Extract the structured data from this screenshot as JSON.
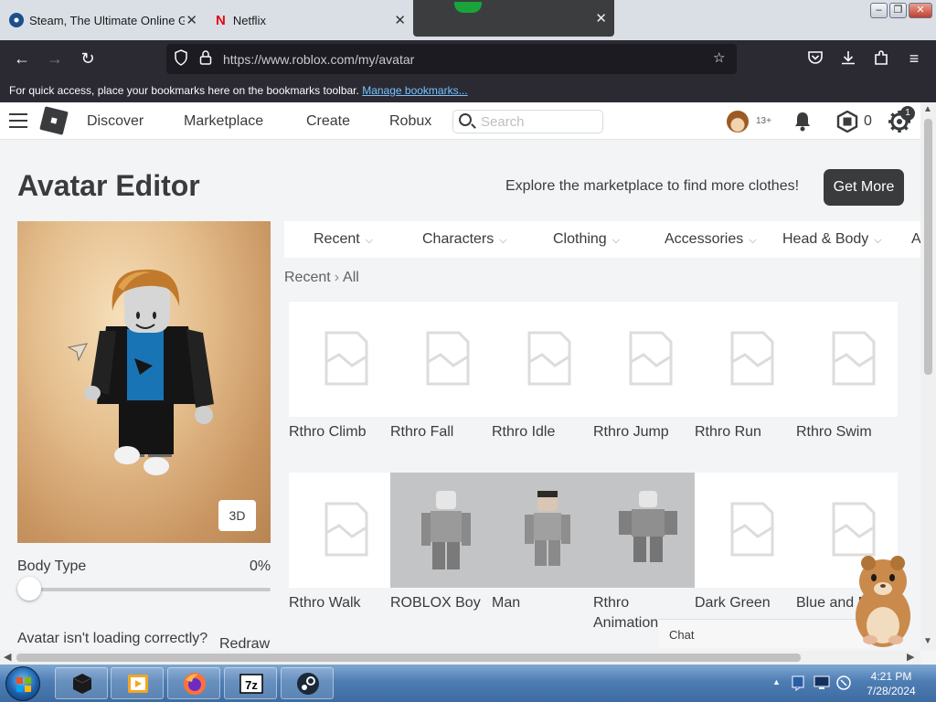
{
  "browser": {
    "tabs": [
      {
        "title": "Steam, The Ultimate Online Game Platform"
      },
      {
        "title": "Netflix"
      },
      {
        "title": ""
      }
    ],
    "url": "https://www.roblox.com/my/avatar",
    "bookmarks_text": "For quick access, place your bookmarks here on the bookmarks toolbar.",
    "bookmarks_link": "Manage bookmarks..."
  },
  "header": {
    "nav": [
      "Discover",
      "Marketplace",
      "Create",
      "Robux"
    ],
    "search_placeholder": "Search",
    "age_badge": "13+",
    "robux_count": "0",
    "settings_badge": "1"
  },
  "page": {
    "title": "Avatar Editor",
    "explore_text": "Explore the marketplace to find more clothes!",
    "get_more": "Get More",
    "view_3d": "3D",
    "body_type_label": "Body Type",
    "body_type_value": "0%",
    "body_type_fraction": 0,
    "not_loading": "Avatar isn't loading correctly?",
    "redraw": "Redraw",
    "categories": [
      "Recent",
      "Characters",
      "Clothing",
      "Accessories",
      "Head & Body",
      "A"
    ],
    "breadcrumb": [
      "Recent",
      "All"
    ],
    "items_row1": [
      "Rthro Climb",
      "Rthro Fall",
      "Rthro Idle",
      "Rthro Jump",
      "Rthro Run",
      "Rthro Swim"
    ],
    "items_row2": [
      "Rthro Walk",
      "ROBLOX Boy",
      "Man",
      "Rthro Animation",
      "Dark Green",
      "Blue and B"
    ],
    "chat_label": "Chat"
  },
  "taskbar": {
    "time": "4:21 PM",
    "date": "7/28/2024"
  },
  "colors": {
    "roblox_text": "#393b3d",
    "button_dark": "#393b3d",
    "browser_toolbar": "#2b2a33",
    "link_blue": "#76c3ff"
  }
}
